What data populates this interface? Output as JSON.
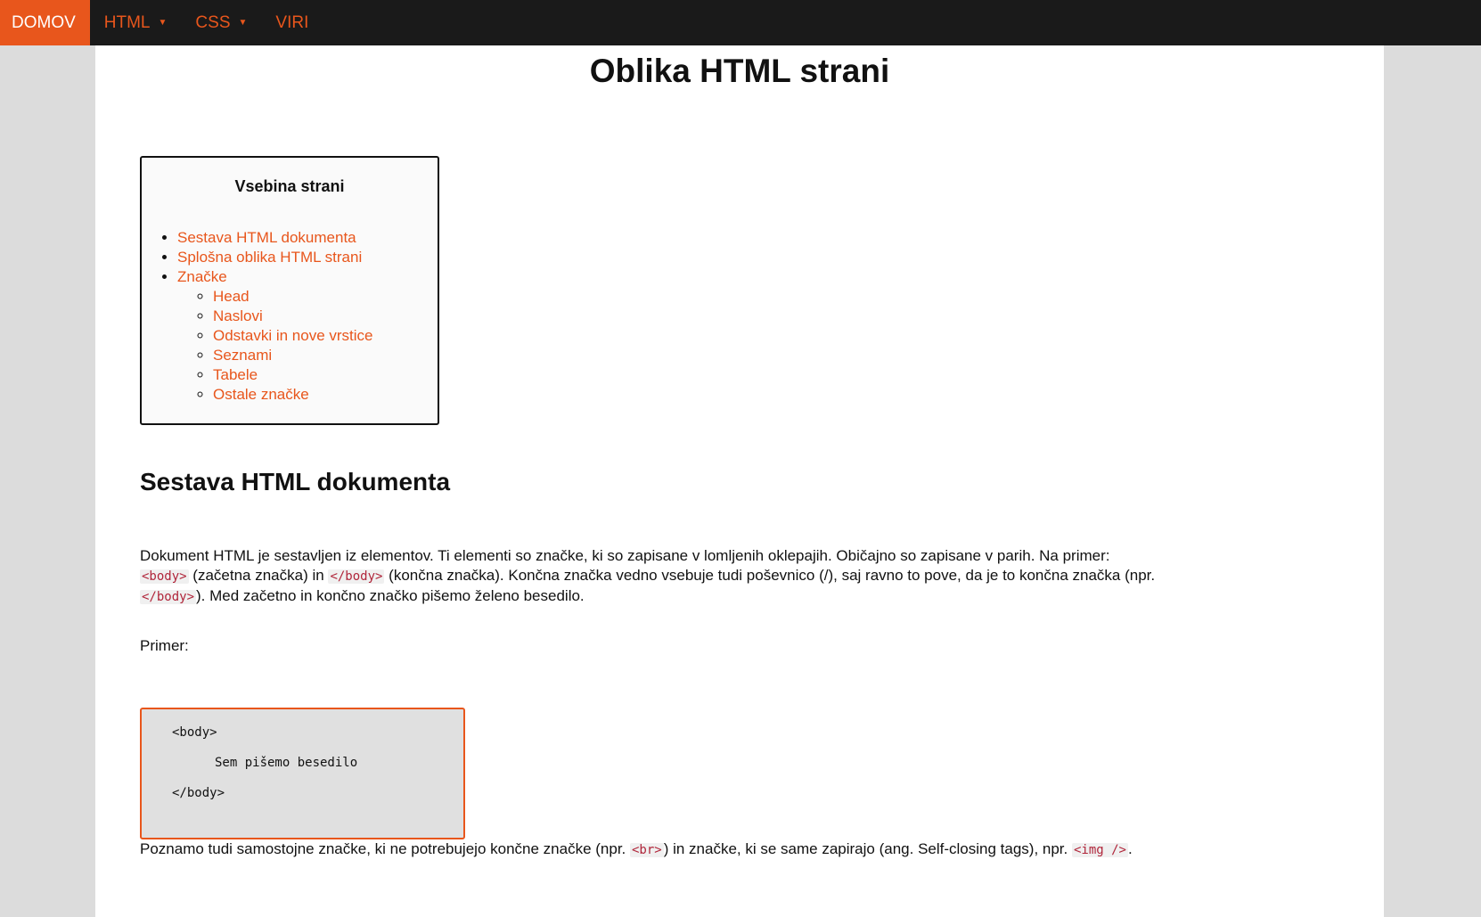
{
  "nav": {
    "items": [
      {
        "label": "DOMOV",
        "active": true,
        "dropdown": false
      },
      {
        "label": "HTML",
        "active": false,
        "dropdown": true
      },
      {
        "label": "CSS",
        "active": false,
        "dropdown": true
      },
      {
        "label": "VIRI",
        "active": false,
        "dropdown": false
      }
    ],
    "caret": "▼"
  },
  "page": {
    "title": "Oblika HTML strani"
  },
  "toc": {
    "title": "Vsebina strani",
    "items": [
      {
        "label": "Sestava HTML dokumenta"
      },
      {
        "label": "Splošna oblika HTML strani"
      },
      {
        "label": "Značke"
      }
    ],
    "subitems": [
      {
        "label": "Head"
      },
      {
        "label": "Naslovi"
      },
      {
        "label": "Odstavki in nove vrstice"
      },
      {
        "label": "Seznami"
      },
      {
        "label": "Tabele"
      },
      {
        "label": "Ostale značke"
      }
    ]
  },
  "section": {
    "title": "Sestava HTML dokumenta",
    "p1": {
      "t1": "Dokument HTML je sestavljen iz elementov. Ti elementi so značke, ki so zapisane v lomljenih oklepajih. Običajno so zapisane v parih. Na primer: ",
      "c1": "<body>",
      "t2": " (začetna značka) in ",
      "c2": "</body>",
      "t3": " (končna značka). Končna značka vedno vsebuje tudi poševnico (/), saj ravno to pove, da je to končna značka (npr. ",
      "c3": "</body>",
      "t4": "). Med začetno in končno značko pišemo želeno besedilo."
    },
    "example_label": "Primer:",
    "example_code": [
      "<body>",
      "Sem pišemo besedilo",
      "</body>"
    ],
    "p2": {
      "t1": "Poznamo tudi samostojne značke, ki ne potrebujejo končne značke (npr. ",
      "c1": "<br>",
      "t2": ") in značke, ki se same zapirajo (ang. Self-closing tags), npr. ",
      "c2": "<img />",
      "t3": "."
    }
  },
  "colors": {
    "accent": "#e8561c",
    "navbar": "#1a1a1a",
    "page_bg": "#dcdcdc",
    "code_text": "#b0253a"
  }
}
